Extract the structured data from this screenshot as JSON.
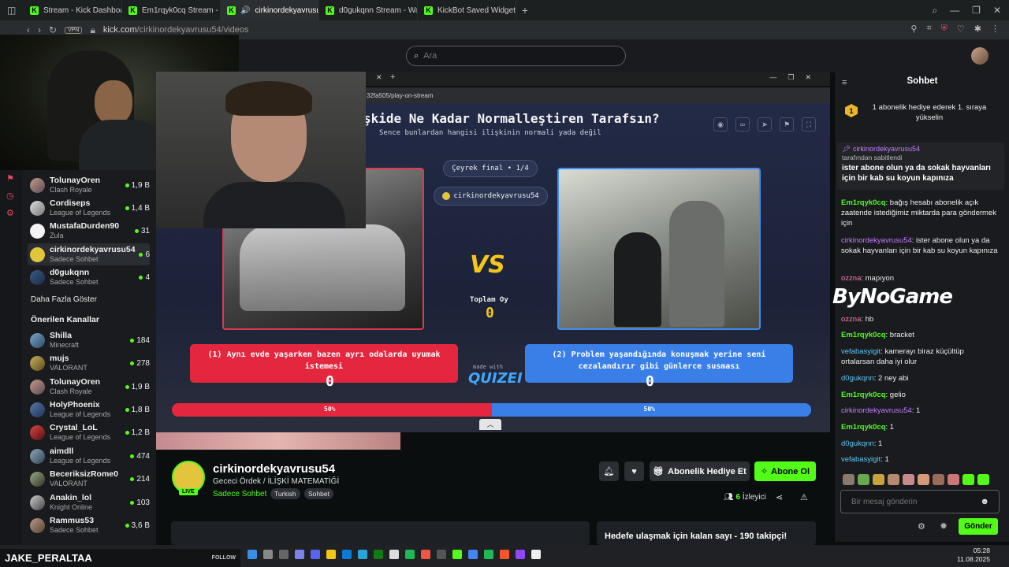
{
  "browser": {
    "tabs": [
      {
        "label": "Stream - Kick Dashboard",
        "active": false
      },
      {
        "label": "Em1rqyk0cq Stream - Wa",
        "active": false
      },
      {
        "label": "cirkinordekyavrusu54",
        "active": true
      },
      {
        "label": "d0gukqnn Stream - Watc",
        "active": false
      },
      {
        "label": "KickBot Saved Widgets",
        "active": false
      }
    ],
    "vpn_label": "VPN",
    "url_host": "kick.com",
    "url_path": "/cirkinordekyavrusu54/videos"
  },
  "search": {
    "placeholder": "Ara"
  },
  "sidebar": {
    "following": [
      {
        "name": "TolunayOren",
        "game": "Clash Royale",
        "viewers": "1,9 B"
      },
      {
        "name": "Cordiseps",
        "game": "League of Legends",
        "viewers": "1,4 B"
      },
      {
        "name": "MustafaDurden90",
        "game": "Zula",
        "viewers": "31"
      },
      {
        "name": "cirkinordekyavrusu54",
        "game": "Sadece Sohbet",
        "viewers": "6"
      },
      {
        "name": "d0gukqnn",
        "game": "Sadece Sohbet",
        "viewers": "4"
      }
    ],
    "show_more": "Daha Fazla Göster",
    "recommended_title": "Önerilen Kanallar",
    "recommended": [
      {
        "name": "Shilla",
        "game": "Minecraft",
        "viewers": "184"
      },
      {
        "name": "mujs",
        "game": "VALORANT",
        "viewers": "278"
      },
      {
        "name": "TolunayOren",
        "game": "Clash Royale",
        "viewers": "1,9 B"
      },
      {
        "name": "HolyPhoenix",
        "game": "League of Legends",
        "viewers": "1,8 B"
      },
      {
        "name": "Crystal_LoL",
        "game": "League of Legends",
        "viewers": "1,2 B"
      },
      {
        "name": "aimdll",
        "game": "League of Legends",
        "viewers": "474"
      },
      {
        "name": "BeceriksizRome0",
        "game": "VALORANT",
        "viewers": "214"
      },
      {
        "name": "Anakin_lol",
        "game": "Knight Online",
        "viewers": "103"
      },
      {
        "name": "Rammus53",
        "game": "Sadece Sohbet",
        "viewers": "3,6 B"
      }
    ]
  },
  "inner_browser": {
    "url": "32fa505/play-on-stream"
  },
  "quiz": {
    "title": "şkide Ne Kadar Normalleştiren Tarafsın?",
    "subtitle": "Sence bunlardan hangisi ilişkinin normali yada değil",
    "round": "Çeyrek final • 1/4",
    "host": "cirkinordekyavrusu54",
    "vs": "VS",
    "total_label": "Toplam Oy",
    "total_value": "0",
    "option_left": "(1) Aynı evde yaşarken bazen ayrı odalarda uyumak istemesi",
    "option_right": "(2) Problem yaşandığında konuşmak yerine seni cezalandırır gibi günlerce susması",
    "left_count": "0",
    "right_count": "0",
    "made_with": "made with",
    "brand": "QUIZEI",
    "left_percent_label": "50%",
    "right_percent_label": "50%",
    "left_share": 50
  },
  "stream": {
    "name": "cirkinordekyavrusu54",
    "title": "Gececi Ördek / İLİŞKİ MATEMATİĞİ",
    "live": "LIVE",
    "category": "Sadece Sohbet",
    "tags": [
      "Turkish",
      "Sohbet"
    ],
    "gift_label": "Abonelik Hediye Et",
    "subscribe_label": "Abone Ol",
    "viewers_count": "6",
    "viewers_label": "İzleyici",
    "goal_text": "Hedefe ulaşmak için kalan sayı - 190 takipçi!"
  },
  "chat": {
    "title": "Sohbet",
    "gift_badge": "1",
    "gift_banner": "1 abonelik hediye ederek 1. sıraya yükselin",
    "pinned_user": "cirkinordekyavrusu54",
    "pinned_by": "tarafından sabitlendi",
    "pinned_msg": "ister abone olun ya da sokak hayvanları için bir kab su koyun kapınıza",
    "messages": [
      {
        "user": "Em1rqyk0cq",
        "text": "bağış hesabı abonelik açık zaatende istediğimiz miktarda para göndermek için"
      },
      {
        "user": "cirkinordekyavrusu54",
        "text": "ister abone olun ya da sokak hayvanları için bir kab su koyun kapınıza"
      },
      {
        "user": "ozzna",
        "text": "mapıyon"
      },
      {
        "user": "ozzna",
        "text": "hb"
      },
      {
        "user": "Em1rqyk0cq",
        "text": "bracket"
      },
      {
        "user": "vefabasyigit",
        "text": "kamerayı biraz küçültüp ortalarsan daha iyi olur"
      },
      {
        "user": "d0gukqnn",
        "text": "2 ney abi"
      },
      {
        "user": "Em1rqyk0cq",
        "text": "gelio"
      },
      {
        "user": "cirkinordekyavrusu54",
        "text": "1"
      },
      {
        "user": "Em1rqyk0cq",
        "text": "1"
      },
      {
        "user": "d0gukqnn",
        "text": "1"
      },
      {
        "user": "vefabasyigit",
        "text": "1"
      }
    ],
    "watermark": "ByNoGame",
    "input_placeholder": "Bir mesaj gönderin",
    "send_label": "Gönder"
  },
  "overlay": {
    "streamer_name": "JAKE_PERALTAA",
    "follow_label": "FOLLOW"
  },
  "clock": {
    "time": "05:28",
    "date": "11.08.2025"
  },
  "colors": {
    "kick_green": "#53fc18",
    "red": "#e4273f",
    "blue": "#3a7fe8",
    "gold": "#f5c518"
  }
}
